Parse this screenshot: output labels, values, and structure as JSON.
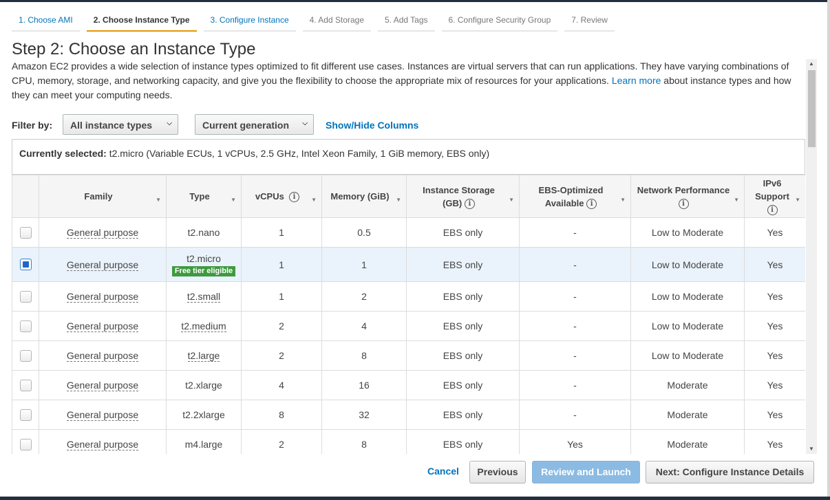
{
  "wizard": {
    "steps": [
      {
        "label": "1. Choose AMI"
      },
      {
        "label": "2. Choose Instance Type"
      },
      {
        "label": "3. Configure Instance"
      },
      {
        "label": "4. Add Storage"
      },
      {
        "label": "5. Add Tags"
      },
      {
        "label": "6. Configure Security Group"
      },
      {
        "label": "7. Review"
      }
    ]
  },
  "page": {
    "title": "Step 2: Choose an Instance Type",
    "intro_text": "Amazon EC2 provides a wide selection of instance types optimized to fit different use cases. Instances are virtual servers that can run applications. They have varying combinations of CPU, memory, storage, and networking capacity, and give you the flexibility to choose the appropriate mix of resources for your applications.",
    "learn_more": "Learn more",
    "intro_suffix": "about instance types and how they can meet your computing needs."
  },
  "filter": {
    "label": "Filter by:",
    "instance_types": "All instance types",
    "generation": "Current generation",
    "show_hide": "Show/Hide Columns"
  },
  "selection": {
    "label": "Currently selected:",
    "value": "t2.micro (Variable ECUs, 1 vCPUs, 2.5 GHz, Intel Xeon Family, 1 GiB memory, EBS only)"
  },
  "table": {
    "headers": {
      "family": "Family",
      "type": "Type",
      "vcpus": "vCPUs",
      "memory": "Memory (GiB)",
      "storage": "Instance Storage (GB)",
      "ebs": "EBS-Optimized Available",
      "network": "Network Performance",
      "ipv6": "IPv6 Support"
    },
    "rows": [
      {
        "family": "General purpose",
        "type": "t2.nano",
        "vcpus": "1",
        "memory": "0.5",
        "storage": "EBS only",
        "ebs": "-",
        "network": "Low to Moderate",
        "ipv6": "Yes"
      },
      {
        "family": "General purpose",
        "type": "t2.micro",
        "badge": "Free tier eligible",
        "vcpus": "1",
        "memory": "1",
        "storage": "EBS only",
        "ebs": "-",
        "network": "Low to Moderate",
        "ipv6": "Yes"
      },
      {
        "family": "General purpose",
        "type": "t2.small",
        "vcpus": "1",
        "memory": "2",
        "storage": "EBS only",
        "ebs": "-",
        "network": "Low to Moderate",
        "ipv6": "Yes"
      },
      {
        "family": "General purpose",
        "type": "t2.medium",
        "vcpus": "2",
        "memory": "4",
        "storage": "EBS only",
        "ebs": "-",
        "network": "Low to Moderate",
        "ipv6": "Yes"
      },
      {
        "family": "General purpose",
        "type": "t2.large",
        "vcpus": "2",
        "memory": "8",
        "storage": "EBS only",
        "ebs": "-",
        "network": "Low to Moderate",
        "ipv6": "Yes"
      },
      {
        "family": "General purpose",
        "type": "t2.xlarge",
        "vcpus": "4",
        "memory": "16",
        "storage": "EBS only",
        "ebs": "-",
        "network": "Moderate",
        "ipv6": "Yes"
      },
      {
        "family": "General purpose",
        "type": "t2.2xlarge",
        "vcpus": "8",
        "memory": "32",
        "storage": "EBS only",
        "ebs": "-",
        "network": "Moderate",
        "ipv6": "Yes"
      },
      {
        "family": "General purpose",
        "type": "m4.large",
        "vcpus": "2",
        "memory": "8",
        "storage": "EBS only",
        "ebs": "Yes",
        "network": "Moderate",
        "ipv6": "Yes"
      }
    ]
  },
  "footer": {
    "cancel": "Cancel",
    "previous": "Previous",
    "review": "Review and Launch",
    "next": "Next: Configure Instance Details"
  },
  "icons": {
    "info": "info-icon",
    "caret": "chevron-down-icon",
    "sort": "sort-icon"
  },
  "colors": {
    "link": "#0073bb",
    "active_step_underline": "#e59400",
    "badge": "#3f9a3f",
    "selected_row": "#eaf3fb",
    "primary_button": "#8bbbe2"
  }
}
